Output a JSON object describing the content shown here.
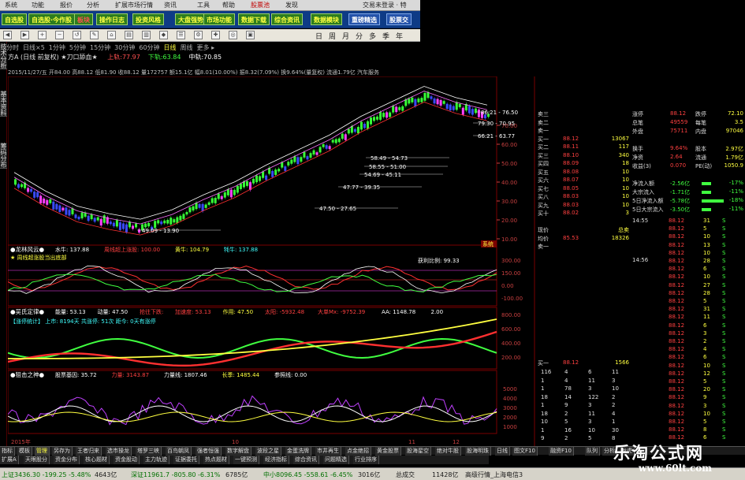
{
  "menubar": {
    "items": [
      "系统",
      "功能",
      "报价",
      "分析",
      "扩展市场行情",
      "资讯",
      "工具",
      "帮助",
      "股票池",
      "发现"
    ],
    "right": "交易未登录 · 特"
  },
  "toolbar": {
    "buttons": [
      {
        "label": "自选股",
        "style": "green"
      },
      {
        "label": "自选股·今作股",
        "style": "green"
      },
      {
        "label": "板块",
        "style": "red"
      },
      {
        "label": "操作日志",
        "style": "green"
      },
      {
        "label": "投资风格",
        "style": "green"
      },
      {
        "label": "大盘强势",
        "style": "green"
      },
      {
        "label": "市场功能",
        "style": "green"
      },
      {
        "label": "数据下载",
        "style": "green"
      },
      {
        "label": "综合资讯",
        "style": "green"
      },
      {
        "label": "数据模块",
        "style": "green"
      },
      {
        "label": "重磅精选",
        "style": "blue"
      },
      {
        "label": "股票交",
        "style": "blue"
      }
    ]
  },
  "navbar": {
    "items": [
      "日",
      "周",
      "月",
      "分",
      "多",
      "季",
      "年"
    ]
  },
  "periodbar": {
    "items": [
      "分时",
      "日线×5",
      "1分钟",
      "5分钟",
      "15分钟",
      "30分钟",
      "60分钟",
      "日线",
      "周线",
      "更多 ▸"
    ]
  },
  "leftstrip": [
    "技术分析",
    "基本资料",
    "筹码分布"
  ],
  "stockhead": {
    "name": "方A (日线 前复权) ★刀口舔血★",
    "fields": [
      {
        "k": "上轨:",
        "v": "77.97"
      },
      {
        "k": "下轨:",
        "v": "63.84"
      },
      {
        "k": "中轨:",
        "v": "70.85"
      }
    ]
  },
  "datebar": {
    "text": "2015/11/27/五 开84.00 高88.12 低81.90 收88.12 量172757 额15.1亿 幅8.01(10.00%) 振8.32(7.09%) 换9.64%(量复权) 流通1.79亿 汽车服务"
  },
  "price_axis": [
    "70.00",
    "60.00",
    "50.00",
    "40.00",
    "30.00",
    "20.00",
    "10.00"
  ],
  "price_labels": [
    {
      "t": "49.09 - 13.90"
    },
    {
      "t": "47.50 - 27.65"
    },
    {
      "t": "47.77 - 39.35"
    },
    {
      "t": "54.69 - 45.11"
    },
    {
      "t": "58.55 - 51.00"
    },
    {
      "t": "58.49 - 54.73"
    },
    {
      "t": "66.21 - 63.77"
    },
    {
      "t": "79.30 - 70.95"
    },
    {
      "t": "86.21 - 76.50"
    }
  ],
  "ind1": {
    "title": "●龙林风云●",
    "fields": [
      {
        "k": "水牛:",
        "v": "137.88"
      },
      {
        "k": "周线超上涨股:",
        "v": "100.00"
      },
      {
        "k": "黄牛:",
        "v": "104.79"
      },
      {
        "k": "牦牛:",
        "v": "137.88"
      }
    ],
    "note": "★ 周线超涨股当出底部",
    "profit": "获利比例: 99.33",
    "axis": [
      "300.00",
      "150.00",
      "0.00",
      "-100.00"
    ],
    "tag": "系统"
  },
  "ind2": {
    "title": "●吴氏定律●",
    "fields": [
      {
        "k": "能量:",
        "v": "53.13"
      },
      {
        "k": "动量:",
        "v": "47.50"
      },
      {
        "k": "抢往下跌:",
        "v": ""
      },
      {
        "k": "加速度:",
        "v": "53.13"
      },
      {
        "k": "作用:",
        "v": "47.50"
      },
      {
        "k": "太阳:",
        "v": "-5932.48"
      },
      {
        "k": "大单Mx:",
        "v": "-9752.39"
      },
      {
        "k": "AA:",
        "v": "1148.78"
      },
      {
        "k": "",
        "v": "2.00"
      }
    ],
    "note": "【涨停统计】 上市: 8194天 共涨停: 51次 距今: 0天有涨停",
    "axis": [
      "800.00",
      "600.00",
      "400.00",
      "200.00"
    ]
  },
  "ind3": {
    "title": "●狙击之神●",
    "fields": [
      {
        "k": "股票基因:",
        "v": "35.72"
      },
      {
        "k": "力量:",
        "v": "3143.87"
      },
      {
        "k": "力量线:",
        "v": "1807.46"
      },
      {
        "k": "长季:",
        "v": "1485.44"
      },
      {
        "k": "参照线:",
        "v": "0.00"
      }
    ],
    "axis": [
      "5000",
      "4000",
      "3000",
      "2000",
      "1000"
    ],
    "xlabels": [
      "2015年",
      "",
      "",
      "",
      "",
      "10",
      "",
      "",
      "",
      "11",
      "12"
    ]
  },
  "quote_left": [
    {
      "k": "卖三",
      "v": "",
      "n": ""
    },
    {
      "k": "卖二",
      "v": "",
      "n": ""
    },
    {
      "k": "卖一",
      "v": "",
      "n": ""
    },
    {
      "k": "买一",
      "v": "88.12",
      "n": "13067"
    },
    {
      "k": "买二",
      "v": "88.11",
      "n": "117"
    },
    {
      "k": "买三",
      "v": "88.10",
      "n": "340"
    },
    {
      "k": "买四",
      "v": "88.09",
      "n": "18"
    },
    {
      "k": "买五",
      "v": "88.08",
      "n": "10"
    },
    {
      "k": "买六",
      "v": "88.07",
      "n": "10"
    },
    {
      "k": "买七",
      "v": "88.05",
      "n": "10"
    },
    {
      "k": "买八",
      "v": "88.03",
      "n": "10"
    },
    {
      "k": "买九",
      "v": "88.03",
      "n": "10"
    },
    {
      "k": "买十",
      "v": "88.02",
      "n": "3"
    },
    {
      "k": "",
      "v": "",
      "n": ""
    },
    {
      "k": "现价",
      "v": "",
      "n": "总卖"
    },
    {
      "k": "均价",
      "v": "85.53",
      "n": "18326"
    },
    {
      "k": "卖一",
      "v": "",
      "n": ""
    }
  ],
  "quote_right": [
    {
      "k": "涨停",
      "v": "88.12",
      "k2": "跌停",
      "n": "72.10"
    },
    {
      "k": "总笔",
      "v": "49559",
      "k2": "每笔",
      "n": "3.5"
    },
    {
      "k": "外盘",
      "v": "75711",
      "k2": "内盘",
      "n": "97046"
    },
    {
      "k": "",
      "v": "",
      "k2": "",
      "n": ""
    },
    {
      "k": "换手",
      "v": "9.64%",
      "k2": "股本",
      "n": "2.97亿"
    },
    {
      "k": "净资",
      "v": "2.64",
      "k2": "流通",
      "n": "1.79亿"
    },
    {
      "k": "收益(3)",
      "v": "0.070",
      "k2": "PE(动)",
      "n": "1050.9"
    },
    {
      "k": "",
      "v": "",
      "k2": "",
      "n": ""
    },
    {
      "k": "净流入额",
      "v": "-2.56亿",
      "k2": "",
      "n": "-17%"
    },
    {
      "k": "大宗流入",
      "v": "-1.71亿",
      "k2": "",
      "n": "-11%"
    },
    {
      "k": "5日净流入额",
      "v": "-5.78亿",
      "k2": "",
      "n": "-18%"
    },
    {
      "k": "5日大宗流入",
      "v": "-3.50亿",
      "k2": "",
      "n": "-11%"
    }
  ],
  "ticks_right": {
    "time1": "14:55",
    "time2": "14:56",
    "rows": [
      {
        "p": "88.12",
        "n": "31",
        "s": "S"
      },
      {
        "p": "88.12",
        "n": "5",
        "s": "S"
      },
      {
        "p": "88.12",
        "n": "10",
        "s": "S"
      },
      {
        "p": "88.12",
        "n": "13",
        "s": "S"
      },
      {
        "p": "88.12",
        "n": "10",
        "s": "S"
      },
      {
        "p": "88.12",
        "n": "28",
        "s": "S"
      },
      {
        "p": "88.12",
        "n": "6",
        "s": "S"
      },
      {
        "p": "88.12",
        "n": "10",
        "s": "S"
      },
      {
        "p": "88.12",
        "n": "27",
        "s": "S"
      },
      {
        "p": "88.12",
        "n": "28",
        "s": "S"
      },
      {
        "p": "88.12",
        "n": "5",
        "s": "S"
      },
      {
        "p": "88.12",
        "n": "31",
        "s": "S"
      },
      {
        "p": "88.12",
        "n": "11",
        "s": "S"
      },
      {
        "p": "88.12",
        "n": "6",
        "s": "S"
      },
      {
        "p": "88.12",
        "n": "3",
        "s": "S"
      },
      {
        "p": "88.12",
        "n": "2",
        "s": "S"
      },
      {
        "p": "88.12",
        "n": "4",
        "s": "S"
      },
      {
        "p": "88.12",
        "n": "6",
        "s": "S"
      },
      {
        "p": "88.12",
        "n": "10",
        "s": "S"
      },
      {
        "p": "88.12",
        "n": "12",
        "s": "S"
      },
      {
        "p": "88.12",
        "n": "5",
        "s": "S"
      },
      {
        "p": "88.12",
        "n": "20",
        "s": "S"
      },
      {
        "p": "88.12",
        "n": "9",
        "s": "S"
      },
      {
        "p": "88.12",
        "n": "3",
        "s": "S"
      },
      {
        "p": "88.12",
        "n": "10",
        "s": "S"
      },
      {
        "p": "88.12",
        "n": "5",
        "s": "S"
      },
      {
        "p": "88.12",
        "n": "8",
        "s": "S"
      },
      {
        "p": "88.12",
        "n": "6",
        "s": "S"
      }
    ]
  },
  "ticks_left": {
    "head": {
      "k": "买一",
      "v": "88.12",
      "n": "1566"
    },
    "rows": [
      [
        "116",
        "4",
        "6",
        "11"
      ],
      [
        "1",
        "4",
        "11",
        "3"
      ],
      [
        "1",
        "78",
        "3",
        "10"
      ],
      [
        "18",
        "14",
        "122",
        "2"
      ],
      [
        "1",
        "9",
        "3",
        "2"
      ],
      [
        "18",
        "2",
        "11",
        "4"
      ],
      [
        "10",
        "5",
        "3",
        "1"
      ],
      [
        "1",
        "16",
        "10",
        "30"
      ],
      [
        "9",
        "2",
        "5",
        "8"
      ]
    ]
  },
  "bottomtabs": [
    "指标",
    "模板",
    "管理",
    "另存为",
    "王者归来",
    "选市操龙",
    "塔罗三峡",
    "百鸟朝凤",
    "强者恒强",
    "数字解盘",
    "波段之星",
    "金蛋洗牌",
    "市井再生",
    "点金绝招",
    "黄金股票",
    "股海星空",
    "绝对牛股",
    "股海明珠",
    "日线",
    "图文F10",
    "融资F10",
    "队列",
    "分析",
    "龙虎"
  ],
  "tabs2": [
    "扩展A",
    "天眼股分",
    "资金分布",
    "核心题材",
    "资金股动",
    "主力轨迹",
    "证据委托",
    "热点题材",
    "一键预测",
    "经济指标",
    "综合资讯",
    "问题精选",
    "行业排序"
  ],
  "status": {
    "items": [
      {
        "t": "上证3436.30 -199.25 -5.48%",
        "c": "g"
      },
      {
        "t": "4643亿",
        "c": ""
      },
      {
        "t": "深证11961.7 -805.80 -6.31%",
        "c": "g"
      },
      {
        "t": "6785亿",
        "c": ""
      },
      {
        "t": "中小8096.45 -558.61 -6.45%",
        "c": "g"
      },
      {
        "t": "3016亿",
        "c": ""
      },
      {
        "t": "总成交",
        "c": ""
      },
      {
        "t": "11428亿",
        "c": ""
      },
      {
        "t": "高级行情_上海电信3",
        "c": ""
      }
    ]
  },
  "watermark": {
    "line1": "乐淘公式网",
    "line2": "www.60lt.com"
  },
  "colors": {
    "up": "#ff3030",
    "down": "#00ffff",
    "candle_up": "#36ff36",
    "candle_down": "#3a4bff",
    "magenta": "#ff40ff",
    "yellow": "#ffff40",
    "axis": "#c84040"
  },
  "chart_data": {
    "type": "line",
    "x": [
      "2015年",
      "10",
      "11",
      "12"
    ],
    "series": [
      {
        "values": [
          40,
          30,
          22,
          18,
          15,
          20,
          28,
          35,
          44,
          52,
          60,
          70,
          78,
          86,
          80,
          76
        ]
      }
    ],
    "ylim": [
      10,
      90
    ]
  }
}
